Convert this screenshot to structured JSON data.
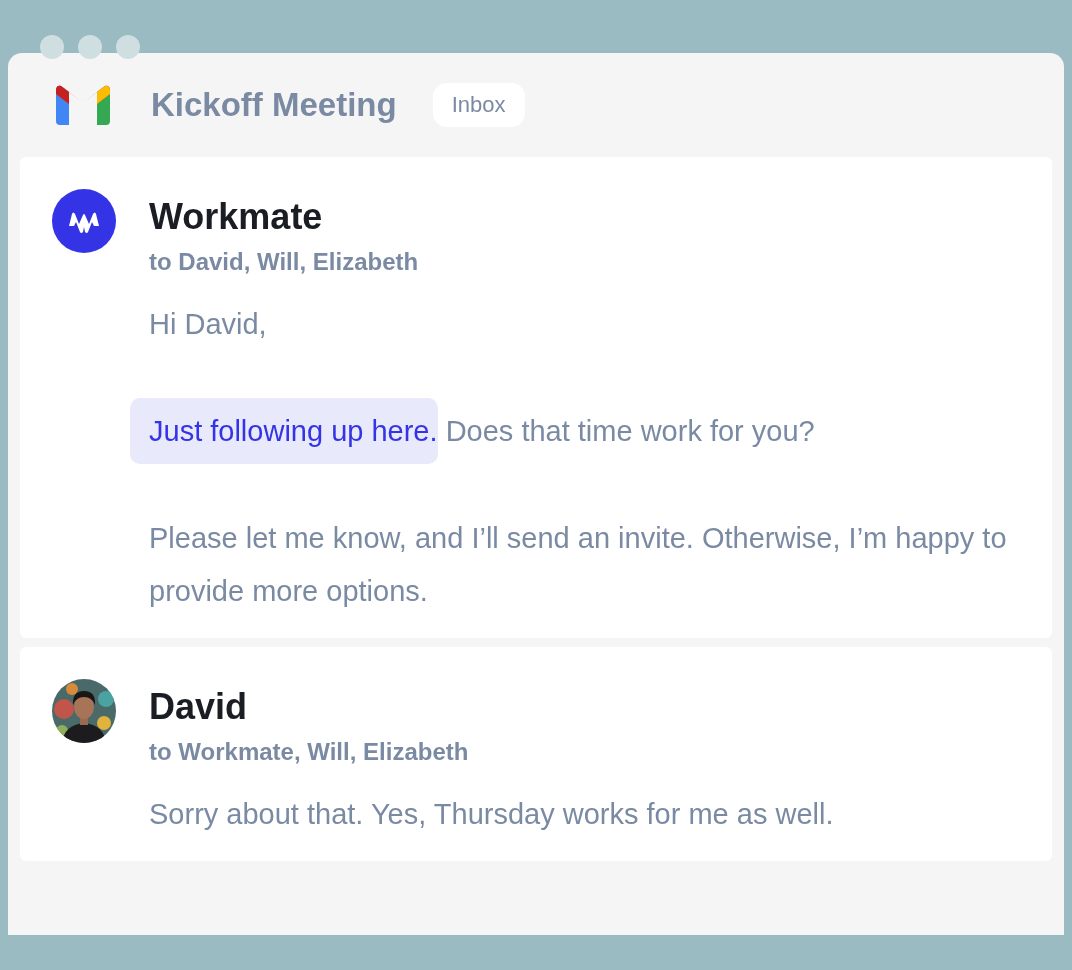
{
  "window": {
    "title": "Kickoff Meeting",
    "folder": "Inbox"
  },
  "messages": [
    {
      "sender": "Workmate",
      "avatar": {
        "kind": "logo"
      },
      "recipients": "to David, Will, Elizabeth",
      "paragraphs": [
        [
          {
            "text": "Hi David,",
            "highlighted": false
          }
        ],
        [
          {
            "text": "Just following up here.",
            "highlighted": true
          },
          {
            "text": "Does that time work for you?",
            "highlighted": false
          }
        ],
        [
          {
            "text": "Please let me know, and I’ll send an invite. Otherwise, I’m happy to provide more options.",
            "highlighted": false
          }
        ]
      ]
    },
    {
      "sender": "David",
      "avatar": {
        "kind": "picture"
      },
      "recipients": "to Workmate, Will, Elizabeth",
      "paragraphs": [
        [
          {
            "text": "Sorry about that. Yes, Thursday works for me as well.",
            "highlighted": false
          }
        ]
      ]
    }
  ]
}
